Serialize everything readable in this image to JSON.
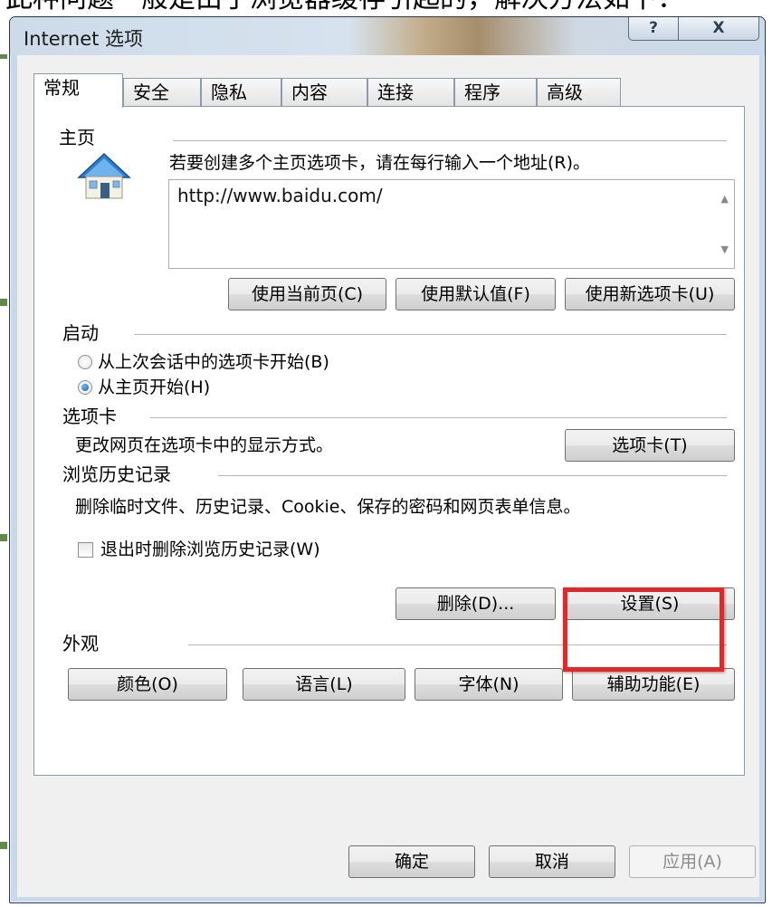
{
  "page_caption": "此种问题一般是由于浏览器缓存引起的，解决方法如下：",
  "window": {
    "title": "Internet 选项",
    "help_button": "?",
    "close_button": "X"
  },
  "tabs": [
    {
      "label": "常规",
      "active": true
    },
    {
      "label": "安全",
      "active": false
    },
    {
      "label": "隐私",
      "active": false
    },
    {
      "label": "内容",
      "active": false
    },
    {
      "label": "连接",
      "active": false
    },
    {
      "label": "程序",
      "active": false
    },
    {
      "label": "高级",
      "active": false
    }
  ],
  "homepage": {
    "section_title": "主页",
    "instructions": "若要创建多个主页选项卡，请在每行输入一个地址(R)。",
    "url_value": "http://www.baidu.com/",
    "buttons": {
      "use_current": "使用当前页(C)",
      "use_default": "使用默认值(F)",
      "use_new_tab": "使用新选项卡(U)"
    }
  },
  "startup": {
    "section_title": "启动",
    "options": [
      {
        "label": "从上次会话中的选项卡开始(B)",
        "checked": false
      },
      {
        "label": "从主页开始(H)",
        "checked": true
      }
    ]
  },
  "tabs_section": {
    "section_title": "选项卡",
    "description": "更改网页在选项卡中的显示方式。",
    "button": "选项卡(T)"
  },
  "history": {
    "section_title": "浏览历史记录",
    "description": "删除临时文件、历史记录、Cookie、保存的密码和网页表单信息。",
    "delete_on_exit_label": "退出时删除浏览历史记录(W)",
    "delete_on_exit_checked": false,
    "delete_button": "删除(D)...",
    "settings_button": "设置(S)"
  },
  "appearance": {
    "section_title": "外观",
    "buttons": {
      "colors": "颜色(O)",
      "languages": "语言(L)",
      "fonts": "字体(N)",
      "accessibility": "辅助功能(E)"
    }
  },
  "footer": {
    "ok": "确定",
    "cancel": "取消",
    "apply": "应用(A)"
  },
  "colors": {
    "highlight": "#e02a2a"
  }
}
